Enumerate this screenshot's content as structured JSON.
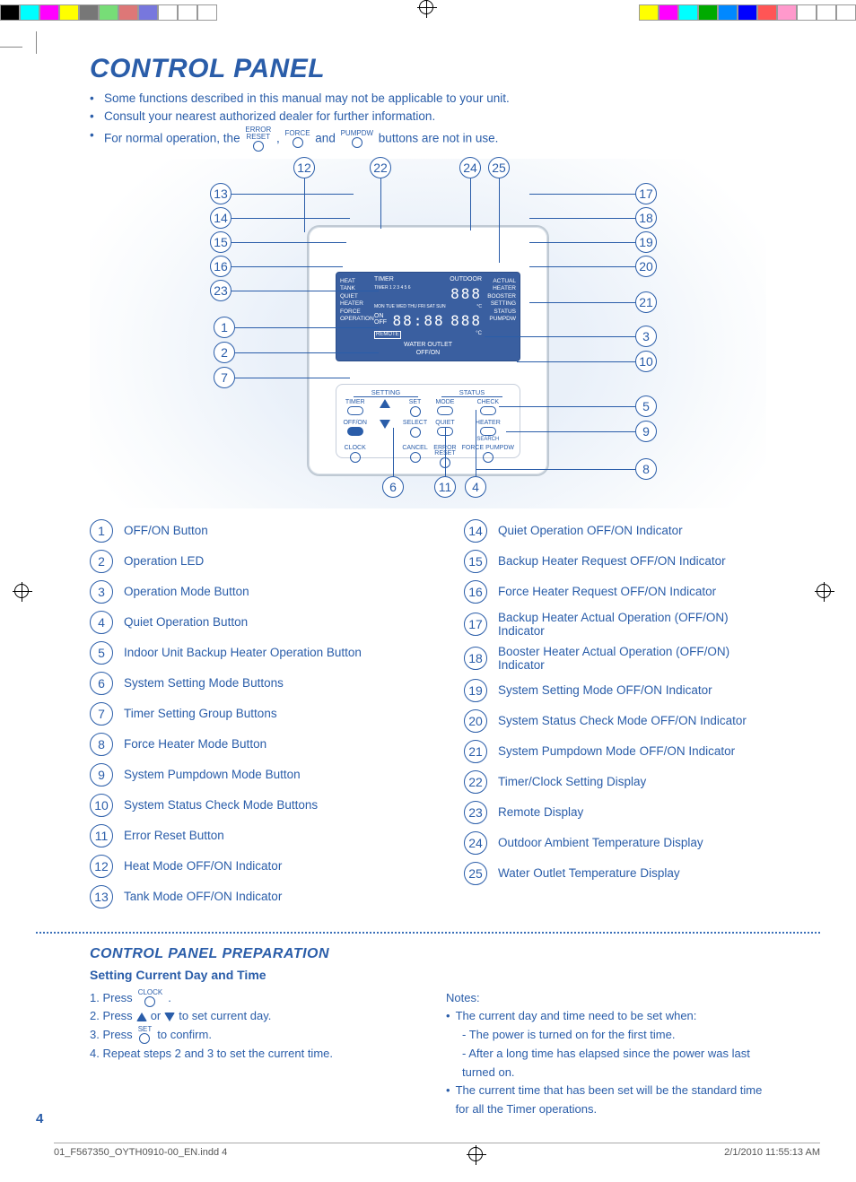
{
  "title": "CONTROL PANEL",
  "intro": {
    "b1": "Some functions described in this manual may not be applicable to your unit.",
    "b2": "Consult your nearest authorized dealer for further information.",
    "b3a": "For normal operation, the",
    "b3b": " , ",
    "b3c": " and ",
    "b3d": " buttons are not in use.",
    "icon1a": "ERROR",
    "icon1b": "RESET",
    "icon2": "FORCE",
    "icon3": "PUMPDW"
  },
  "lcd": {
    "heat": "HEAT",
    "tank": "TANK",
    "quiet": "QUIET",
    "heater": "HEATER",
    "force": "FORCE",
    "operation": "OPERATION",
    "timer": "TIMER",
    "outdoor": "OUTDOOR",
    "actual": "ACTUAL",
    "heater2": "HEATER",
    "booster": "BOOSTER",
    "setting": "SETTING",
    "status": "STATUS",
    "pumpdw": "PUMPDW",
    "onrow": "ON",
    "offrow": "OFF",
    "remote": "REMOTE",
    "water": "WATER OUTLET",
    "offon": "OFF/ON",
    "days": "MON TUE WED THU FRI SAT SUN",
    "timernums": "TIMER 1 2 3 4 5 6",
    "seg1": "888",
    "seg2": "88:88",
    "seg3": "888",
    "degc": "°C"
  },
  "btnarea": {
    "l_setting": "SETTING",
    "l_status": "STATUS",
    "timer": "TIMER",
    "set": "SET",
    "mode": "MODE",
    "check": "CHECK",
    "offon": "OFF/ON",
    "select": "SELECT",
    "quiet": "QUIET",
    "heater": "HEATER",
    "search": "SEARCH",
    "clock": "CLOCK",
    "cancel": "CANCEL",
    "error": "ERROR",
    "reset": "RESET",
    "force": "FORCE",
    "pumpdw": "PUMPDW"
  },
  "legend": [
    {
      "n": "1",
      "t": "OFF/ON Button"
    },
    {
      "n": "2",
      "t": "Operation LED"
    },
    {
      "n": "3",
      "t": "Operation Mode Button"
    },
    {
      "n": "4",
      "t": "Quiet Operation Button"
    },
    {
      "n": "5",
      "t": "Indoor Unit Backup Heater Operation Button"
    },
    {
      "n": "6",
      "t": "System Setting Mode Buttons"
    },
    {
      "n": "7",
      "t": "Timer Setting Group Buttons"
    },
    {
      "n": "8",
      "t": "Force Heater Mode Button"
    },
    {
      "n": "9",
      "t": "System Pumpdown Mode Button"
    },
    {
      "n": "10",
      "t": "System Status Check Mode Buttons"
    },
    {
      "n": "11",
      "t": "Error Reset Button"
    },
    {
      "n": "12",
      "t": "Heat Mode OFF/ON Indicator"
    },
    {
      "n": "13",
      "t": "Tank Mode OFF/ON Indicator"
    },
    {
      "n": "14",
      "t": "Quiet Operation OFF/ON Indicator"
    },
    {
      "n": "15",
      "t": "Backup Heater Request OFF/ON Indicator"
    },
    {
      "n": "16",
      "t": "Force Heater Request OFF/ON Indicator"
    },
    {
      "n": "17",
      "t": "Backup Heater Actual Operation (OFF/ON) Indicator"
    },
    {
      "n": "18",
      "t": "Booster Heater Actual Operation (OFF/ON) Indicator"
    },
    {
      "n": "19",
      "t": "System Setting Mode OFF/ON Indicator"
    },
    {
      "n": "20",
      "t": "System Status Check Mode OFF/ON Indicator"
    },
    {
      "n": "21",
      "t": "System Pumpdown Mode OFF/ON Indicator"
    },
    {
      "n": "22",
      "t": "Timer/Clock Setting Display"
    },
    {
      "n": "23",
      "t": "Remote Display"
    },
    {
      "n": "24",
      "t": "Outdoor Ambient Temperature Display"
    },
    {
      "n": "25",
      "t": "Water Outlet Temperature Display"
    }
  ],
  "prep": {
    "heading": "CONTROL PANEL PREPARATION",
    "sub": "Setting Current Day and Time",
    "s1a": "1. Press ",
    "s1_icon": "CLOCK",
    "s1b": " .",
    "s2a": "2. Press ",
    "s2b": " or ",
    "s2c": " to set current day.",
    "s3a": "3. Press ",
    "s3_icon": "SET",
    "s3b": " to confirm.",
    "s4": "4. Repeat steps 2 and 3 to set the current time."
  },
  "notes": {
    "heading": "Notes:",
    "n1": "The current day and time need to be set when:",
    "n1a": "-  The power is turned on for the first time.",
    "n1b": "-  After a long time has elapsed since the power was last turned on.",
    "n2": "The current time that has been set will be the standard time for all the Timer operations."
  },
  "page": "4",
  "footer_l": "01_F567350_OYTH0910-00_EN.indd   4",
  "footer_r": "2/1/2010   11:55:13 AM"
}
